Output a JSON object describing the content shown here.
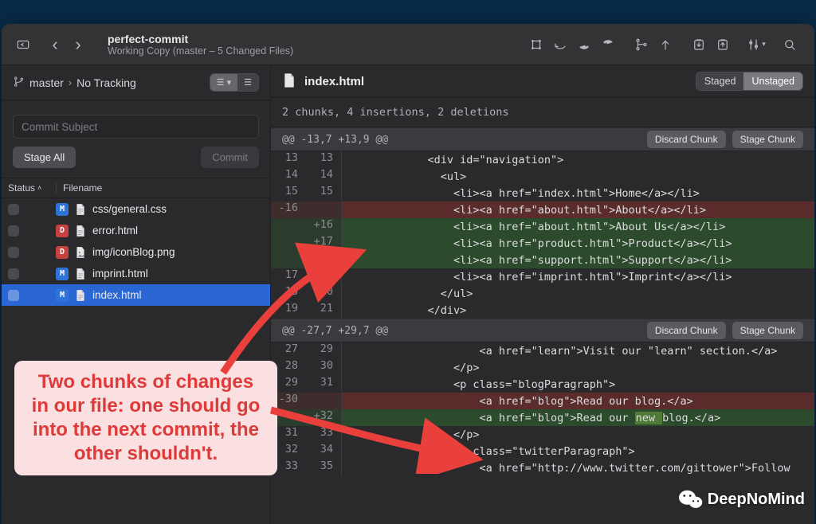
{
  "header": {
    "title": "perfect-commit",
    "subtitle": "Working Copy (master – 5 Changed Files)"
  },
  "sidebar": {
    "branch": "master",
    "tracking": "No Tracking",
    "commit_subject_placeholder": "Commit Subject",
    "stage_all_label": "Stage All",
    "commit_label": "Commit",
    "col_status": "Status",
    "col_filename": "Filename",
    "files": [
      {
        "status": "M",
        "name": "css/general.css",
        "icon": "file"
      },
      {
        "status": "D",
        "name": "error.html",
        "icon": "file"
      },
      {
        "status": "D",
        "name": "img/iconBlog.png",
        "icon": "image"
      },
      {
        "status": "M",
        "name": "imprint.html",
        "icon": "file"
      },
      {
        "status": "M",
        "name": "index.html",
        "icon": "file",
        "selected": true
      }
    ]
  },
  "diff": {
    "filename": "index.html",
    "tab_staged": "Staged",
    "tab_unstaged": "Unstaged",
    "summary": "2 chunks, 4 insertions, 2 deletions",
    "chunks": [
      {
        "range": "@@ -13,7 +13,9 @@",
        "discard_label": "Discard Chunk",
        "stage_label": "Stage Chunk",
        "lines": [
          {
            "ol": "13",
            "nl": "13",
            "t": "ctx",
            "text": "            <div id=\"navigation\">"
          },
          {
            "ol": "14",
            "nl": "14",
            "t": "ctx",
            "text": "              <ul>"
          },
          {
            "ol": "15",
            "nl": "15",
            "t": "ctx",
            "text": "                <li><a href=\"index.html\">Home</a></li>"
          },
          {
            "ol": "-16",
            "nl": "",
            "t": "del",
            "text": "                <li><a href=\"about.html\">About</a></li>"
          },
          {
            "ol": "",
            "nl": "+16",
            "t": "add",
            "text": "                <li><a href=\"about.html\">About Us</a></li>"
          },
          {
            "ol": "",
            "nl": "+17",
            "t": "add",
            "text": "                <li><a href=\"product.html\">Product</a></li>"
          },
          {
            "ol": "",
            "nl": "+18",
            "t": "add",
            "text": "                <li><a href=\"support.html\">Support</a></li>"
          },
          {
            "ol": "17",
            "nl": "19",
            "t": "ctx",
            "text": "                <li><a href=\"imprint.html\">Imprint</a></li>"
          },
          {
            "ol": "18",
            "nl": "20",
            "t": "ctx",
            "text": "              </ul>"
          },
          {
            "ol": "19",
            "nl": "21",
            "t": "ctx",
            "text": "            </div>"
          }
        ]
      },
      {
        "range": "@@ -27,7 +29,7 @@",
        "discard_label": "Discard Chunk",
        "stage_label": "Stage Chunk",
        "lines": [
          {
            "ol": "27",
            "nl": "29",
            "t": "ctx",
            "text": "                    <a href=\"learn\">Visit our \"learn\" section.</a>"
          },
          {
            "ol": "28",
            "nl": "30",
            "t": "ctx",
            "text": "                </p>"
          },
          {
            "ol": "29",
            "nl": "31",
            "t": "ctx",
            "text": "                <p class=\"blogParagraph\">"
          },
          {
            "ol": "-30",
            "nl": "",
            "t": "del",
            "text": "                    <a href=\"blog\">Read our blog.</a>"
          },
          {
            "ol": "",
            "nl": "+32",
            "t": "add-hl",
            "prefix": "                    <a href=\"blog\">Read our ",
            "hl": "new ",
            "suffix": "blog.</a>"
          },
          {
            "ol": "31",
            "nl": "33",
            "t": "ctx",
            "text": "                </p>"
          },
          {
            "ol": "32",
            "nl": "34",
            "t": "ctx",
            "text": "                <p class=\"twitterParagraph\">"
          },
          {
            "ol": "33",
            "nl": "35",
            "t": "ctx",
            "text": "                    <a href=\"http://www.twitter.com/gittower\">Follow"
          }
        ]
      }
    ]
  },
  "annotation": "Two chunks of changes in our file: one should go into the next commit, the other shouldn't.",
  "watermark": "DeepNoMind"
}
